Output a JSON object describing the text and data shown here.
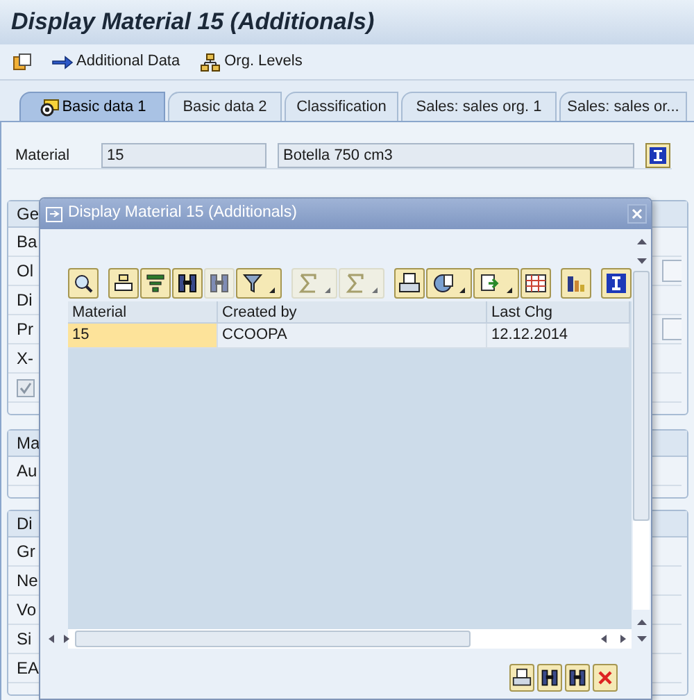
{
  "window": {
    "title": "Display Material 15 (Additionals)"
  },
  "toolbar": {
    "buttons": [
      "Additional Data",
      "Org. Levels"
    ]
  },
  "tabs": [
    {
      "label": "Basic data 1",
      "selected": true
    },
    {
      "label": "Basic data 2",
      "selected": false
    },
    {
      "label": "Classification",
      "selected": false
    },
    {
      "label": "Sales: sales org. 1",
      "selected": false
    },
    {
      "label": "Sales: sales or...",
      "selected": false
    }
  ],
  "material": {
    "label": "Material",
    "number": "15",
    "description": "Botella 750 cm3"
  },
  "groups": [
    {
      "title": "Ge",
      "rows": [
        {
          "kind": "field",
          "label": "Ba"
        },
        {
          "kind": "field",
          "label": "Ol"
        },
        {
          "kind": "field",
          "label": "Di"
        },
        {
          "kind": "field",
          "label": "Pr"
        },
        {
          "kind": "field",
          "label": "X-"
        },
        {
          "kind": "checkbox",
          "checked": true
        }
      ]
    },
    {
      "title": "Ma",
      "rows": [
        {
          "kind": "field",
          "label": "Au"
        }
      ]
    },
    {
      "title": "Di",
      "rows": [
        {
          "kind": "field",
          "label": "Gr"
        },
        {
          "kind": "field",
          "label": "Ne"
        },
        {
          "kind": "field",
          "label": "Vo"
        },
        {
          "kind": "field",
          "label": "Si"
        },
        {
          "kind": "field",
          "label": "EA"
        }
      ]
    }
  ],
  "dialog": {
    "title": "Display Material 15 (Additionals)",
    "table": {
      "columns": [
        {
          "label": "Material",
          "key": true
        },
        {
          "label": "Created by",
          "key": false
        },
        {
          "label": "Last Chg",
          "key": false
        }
      ],
      "rows": [
        {
          "cells": [
            "15",
            "CCOOPA",
            "12.12.2014"
          ]
        }
      ]
    }
  }
}
